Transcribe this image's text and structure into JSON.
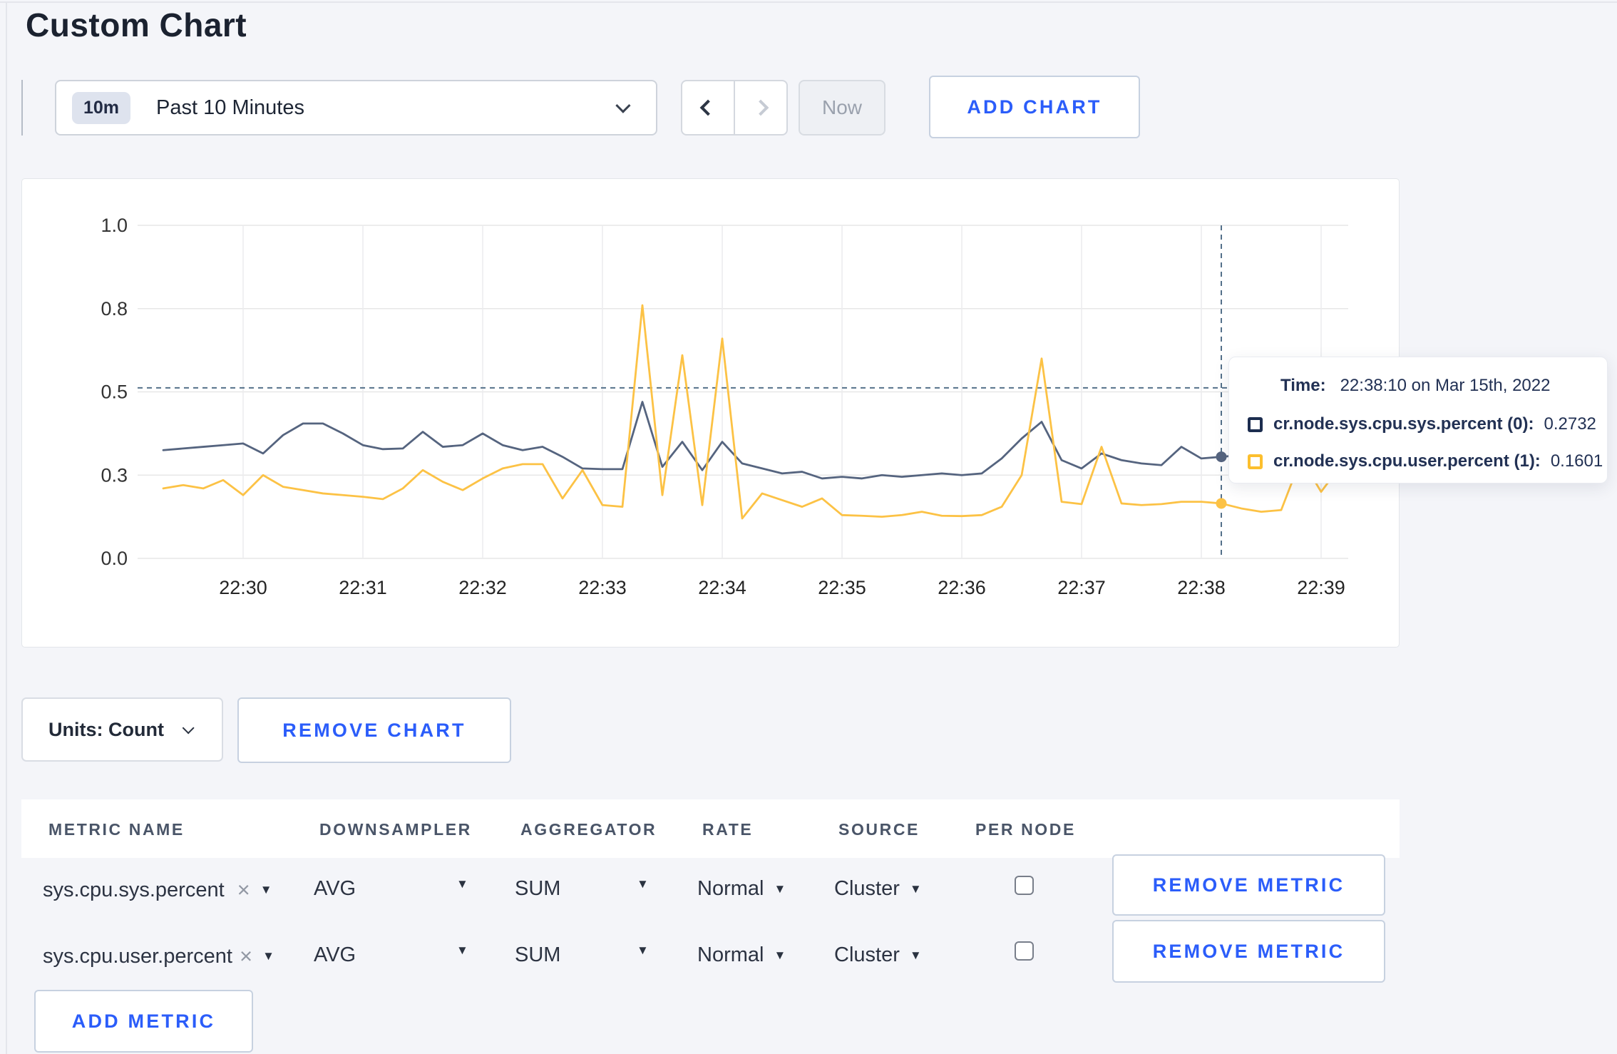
{
  "page": {
    "title": "Custom Chart"
  },
  "toolbar": {
    "range_badge": "10m",
    "range_label": "Past 10 Minutes",
    "now_label": "Now",
    "add_chart_label": "ADD CHART"
  },
  "chart_data": {
    "type": "line",
    "title": "",
    "x_start": "22:29:20",
    "x_step_seconds": 10,
    "x_ticks": [
      "22:30",
      "22:31",
      "22:32",
      "22:33",
      "22:34",
      "22:35",
      "22:36",
      "22:37",
      "22:38",
      "22:39"
    ],
    "y_ticks": [
      {
        "value": 0.0,
        "label": "0.0"
      },
      {
        "value": 0.25,
        "label": "0.3"
      },
      {
        "value": 0.5,
        "label": "0.5"
      },
      {
        "value": 0.75,
        "label": "0.8"
      },
      {
        "value": 1.0,
        "label": "1.0"
      }
    ],
    "ylim": [
      0,
      1
    ],
    "grid": true,
    "series": [
      {
        "name": "cr.node.sys.cpu.sys.percent",
        "color": "#55647f",
        "values": [
          0.325,
          0.33,
          0.335,
          0.34,
          0.345,
          0.315,
          0.37,
          0.405,
          0.405,
          0.375,
          0.34,
          0.328,
          0.33,
          0.38,
          0.335,
          0.34,
          0.375,
          0.34,
          0.325,
          0.335,
          0.305,
          0.27,
          0.268,
          0.268,
          0.47,
          0.275,
          0.35,
          0.265,
          0.35,
          0.285,
          0.27,
          0.255,
          0.26,
          0.24,
          0.245,
          0.24,
          0.25,
          0.245,
          0.25,
          0.255,
          0.25,
          0.255,
          0.3,
          0.36,
          0.41,
          0.295,
          0.27,
          0.315,
          0.295,
          0.285,
          0.28,
          0.335,
          0.3,
          0.305,
          0.31,
          0.3,
          0.3,
          0.295,
          0.3,
          0.31
        ]
      },
      {
        "name": "cr.node.sys.cpu.user.percent",
        "color": "#fcc245",
        "values": [
          0.21,
          0.22,
          0.21,
          0.235,
          0.19,
          0.25,
          0.215,
          0.205,
          0.195,
          0.19,
          0.185,
          0.178,
          0.21,
          0.265,
          0.23,
          0.205,
          0.24,
          0.27,
          0.283,
          0.283,
          0.18,
          0.265,
          0.16,
          0.155,
          0.76,
          0.19,
          0.61,
          0.16,
          0.66,
          0.12,
          0.195,
          0.175,
          0.155,
          0.18,
          0.13,
          0.128,
          0.125,
          0.13,
          0.14,
          0.128,
          0.127,
          0.13,
          0.155,
          0.25,
          0.6,
          0.17,
          0.163,
          0.335,
          0.165,
          0.16,
          0.163,
          0.17,
          0.17,
          0.165,
          0.15,
          0.14,
          0.145,
          0.3,
          0.2,
          0.28
        ]
      }
    ],
    "crosshair": {
      "x_index": 53,
      "time": "22:38:10",
      "hline_value": 0.512,
      "points": [
        {
          "series": 0,
          "value": 0.305
        },
        {
          "series": 1,
          "value": 0.165
        }
      ]
    },
    "legend_position": "tooltip"
  },
  "tooltip": {
    "time_label": "Time:",
    "time_value": "22:38:10 on Mar 15th, 2022",
    "rows": [
      {
        "name": "cr.node.sys.cpu.sys.percent (0):",
        "value": "0.2732",
        "swatch_color": "#1c2d4f"
      },
      {
        "name": "cr.node.sys.cpu.user.percent (1):",
        "value": "0.1601",
        "swatch_color": "#fcbf2e"
      }
    ]
  },
  "chart_footer": {
    "units_label": "Units: Count",
    "remove_chart_label": "REMOVE CHART"
  },
  "metrics_table": {
    "headers": [
      "METRIC NAME",
      "DOWNSAMPLER",
      "AGGREGATOR",
      "RATE",
      "SOURCE",
      "PER NODE"
    ],
    "rows": [
      {
        "metric": "sys.cpu.sys.percent",
        "downsampler": "AVG",
        "aggregator": "SUM",
        "rate": "Normal",
        "source": "Cluster",
        "per_node_checked": false,
        "remove_label": "REMOVE METRIC"
      },
      {
        "metric": "sys.cpu.user.percent",
        "downsampler": "AVG",
        "aggregator": "SUM",
        "rate": "Normal",
        "source": "Cluster",
        "per_node_checked": false,
        "remove_label": "REMOVE METRIC"
      }
    ],
    "add_metric_label": "ADD METRIC"
  }
}
